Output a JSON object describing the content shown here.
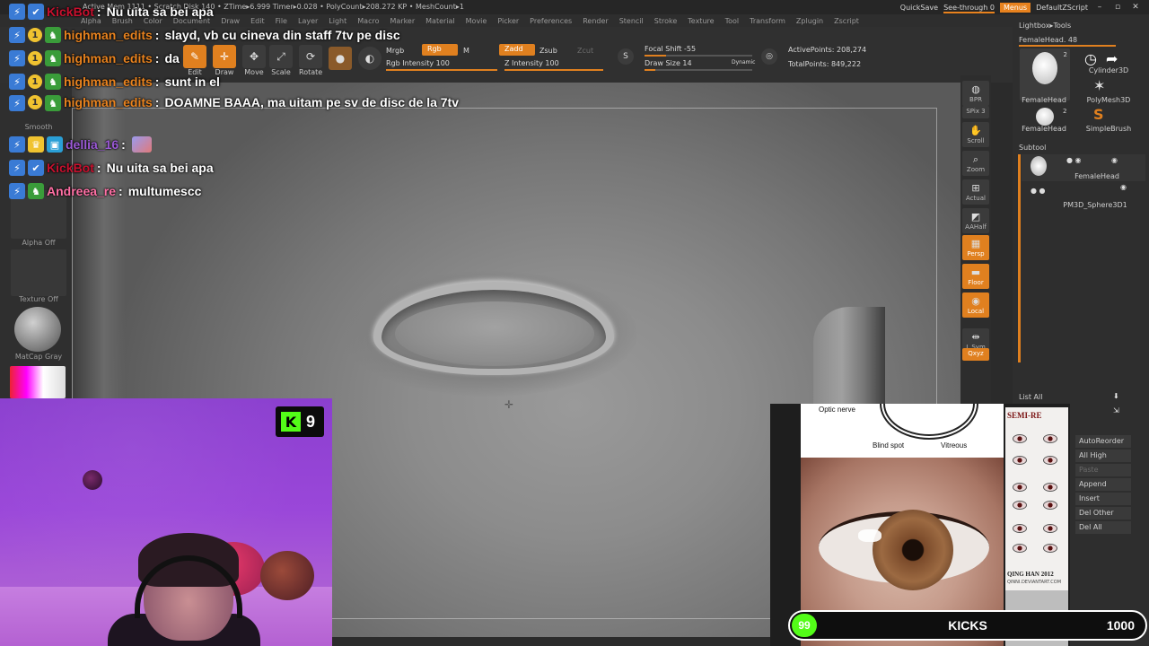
{
  "statusbar": {
    "stats": "Active Mem 1111 • Scratch Disk 140 • ZTime▸6.999 Timer▸0.028 • PolyCount▸208.272 KP • MeshCount▸1",
    "quicksave": "QuickSave",
    "seethrough": "See-through  0",
    "menus": "Menus",
    "defaultzscript": "DefaultZScript"
  },
  "menubar": [
    "Alpha",
    "Brush",
    "Color",
    "Document",
    "Draw",
    "Edit",
    "File",
    "Layer",
    "Light",
    "Macro",
    "Marker",
    "Material",
    "Movie",
    "Picker",
    "Preferences",
    "Render",
    "Stencil",
    "Stroke",
    "Texture",
    "Tool",
    "Transform",
    "Zplugin",
    "Zscript"
  ],
  "toolbar": {
    "edit": "Edit",
    "draw": "Draw",
    "move": "Move",
    "scale": "Scale",
    "rotate": "Rotate",
    "mrgb": "Mrgb",
    "rgb": "Rgb",
    "m": "M",
    "zadd": "Zadd",
    "zsub": "Zsub",
    "zcut": "Zcut",
    "rgb_intensity": "Rgb Intensity 100",
    "z_intensity": "Z Intensity 100",
    "focal_shift": "Focal Shift -55",
    "draw_size": "Draw Size 14",
    "dynamic": "Dynamic",
    "active_points": "ActivePoints: 208,274",
    "total_points": "TotalPoints: 849,222"
  },
  "leftshelf": {
    "smooth": "Smooth",
    "alpha_off": "Alpha Off",
    "texture_off": "Texture Off",
    "matcap": "MatCap Gray"
  },
  "navcol": [
    {
      "label": "BPR",
      "icon": "bpr-icon",
      "active": false
    },
    {
      "label": "SPix 3",
      "icon": "spix-icon",
      "active": false
    },
    {
      "label": "Scroll",
      "icon": "scroll-icon",
      "active": false
    },
    {
      "label": "Zoom",
      "icon": "zoom-icon",
      "active": false
    },
    {
      "label": "Actual",
      "icon": "actual-icon",
      "active": false
    },
    {
      "label": "AAHalf",
      "icon": "aahalf-icon",
      "active": false
    },
    {
      "label": "Persp",
      "icon": "persp-icon",
      "active": true
    },
    {
      "label": "Floor",
      "icon": "floor-icon",
      "active": true
    },
    {
      "label": "Local",
      "icon": "local-icon",
      "active": true
    },
    {
      "label": "L.Sym",
      "icon": "lsym-icon",
      "active": false
    },
    {
      "label": "Qxyz",
      "icon": "xyz-icon",
      "active": true
    }
  ],
  "rightpanel": {
    "lightbox_tools": "Lightbox▸Tools",
    "current_tool": "FemaleHead. 48",
    "tools": [
      {
        "name": "FemaleHead",
        "count": "2"
      },
      {
        "name": "Cylinder3D",
        "count": ""
      },
      {
        "name": "PolyMesh3D",
        "count": ""
      },
      {
        "name": "FemaleHead",
        "count": "2"
      },
      {
        "name": "SimpleBrush",
        "count": ""
      }
    ],
    "subtool_title": "Subtool",
    "subtools": [
      "FemaleHead",
      "PM3D_Sphere3D1"
    ],
    "list_all": "List All",
    "buttons": [
      "AutoReorder",
      "All High",
      "Paste",
      "Append",
      "Insert",
      "Del Other",
      "Del All"
    ]
  },
  "chat": [
    {
      "user": "KickBot",
      "user_color": "#c8102e",
      "msg": "Nu uita sa bei apa",
      "badges": [
        "kick",
        "verified"
      ]
    },
    {
      "user": "highman_edits",
      "user_color": "#e8821e",
      "msg": "slayd, vb cu cineva din staff 7tv pe disc",
      "badges": [
        "kick",
        "sub1",
        "og"
      ]
    },
    {
      "user": "highman_edits",
      "user_color": "#e8821e",
      "msg": "da",
      "badges": [
        "kick",
        "sub1",
        "og"
      ]
    },
    {
      "user": "highman_edits",
      "user_color": "#e8821e",
      "msg": "sunt in el",
      "badges": [
        "kick",
        "sub1",
        "og"
      ]
    },
    {
      "user": "highman_edits",
      "user_color": "#e8821e",
      "msg": "DOAMNE BAAA, ma uitam pe sv de disc de la 7tv",
      "badges": [
        "kick",
        "sub1",
        "og"
      ]
    },
    {
      "user": "dellia_16",
      "user_color": "#9b59d6",
      "msg": "",
      "badges": [
        "kick",
        "crown",
        "vip"
      ],
      "emote": "emote-icon"
    },
    {
      "user": "KickBot",
      "user_color": "#c8102e",
      "msg": "Nu uita sa bei apa",
      "badges": [
        "kick",
        "verified"
      ]
    },
    {
      "user": "Andreea_re",
      "user_color": "#ff6fa4",
      "msg": "multumescc",
      "badges": [
        "kick",
        "og"
      ]
    }
  ],
  "webcam": {
    "kick_count": "9"
  },
  "reference": {
    "optic_nerve": "Optic nerve",
    "blind_spot": "Blind spot",
    "vitreous": "Vitreous",
    "sheet_title": "SEMI-RE",
    "sheet_footer": "QING HAN 2012",
    "sheet_url": "QINNI.DEVIANTART.COM"
  },
  "goal": {
    "current": "99",
    "label": "KICKS",
    "target": "1000"
  }
}
